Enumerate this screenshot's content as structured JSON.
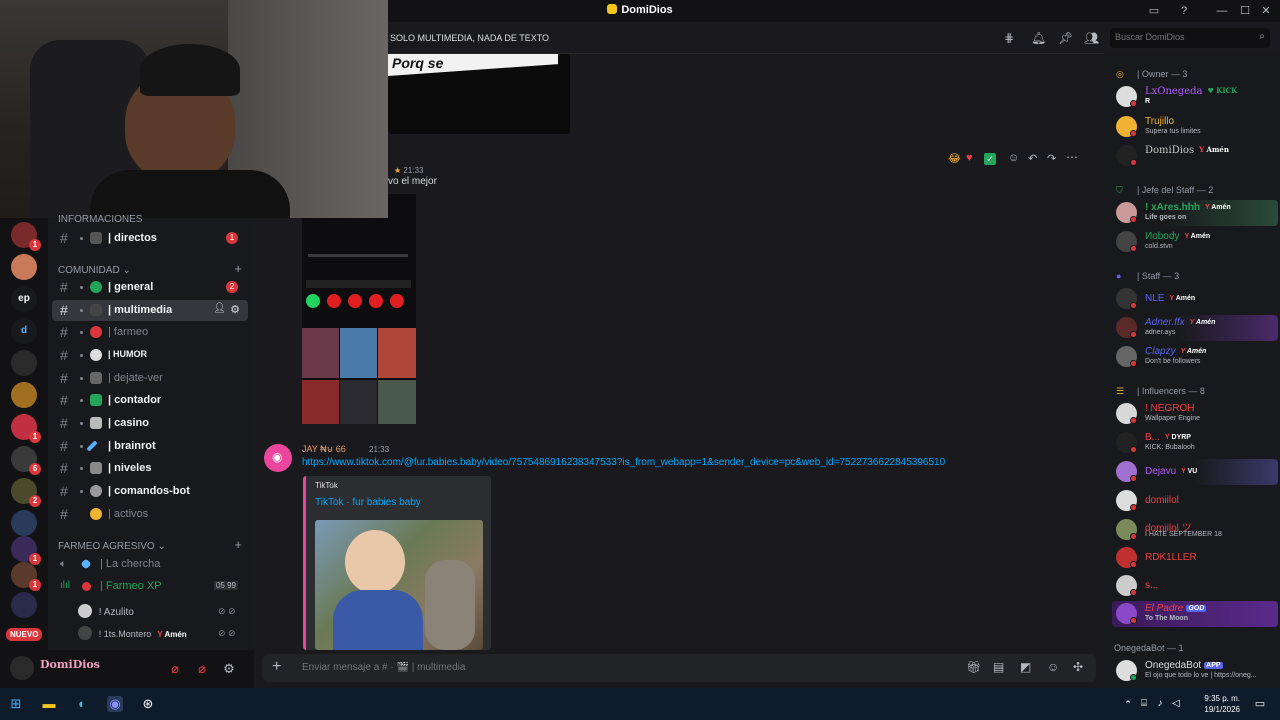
{
  "app": {
    "title": "DomiDios"
  },
  "header": {
    "channel_description": "SOLO MULTIMEDIA, NADA DE TEXTO",
    "search_placeholder": "Buscar DomiDios"
  },
  "servers": {
    "badges": [
      "1",
      "1",
      "6",
      "2",
      "1",
      "1"
    ],
    "ep_label": "ep",
    "new_label": "NUEVO"
  },
  "channels": {
    "cat_info": "INFORMACIONES",
    "directos": {
      "name": "| directos",
      "badge": "1"
    },
    "cat_comunidad": "COMUNIDAD",
    "items": [
      {
        "name": "| general",
        "badge": "2"
      },
      {
        "name": "| multimedia"
      },
      {
        "name": "| farmeo"
      },
      {
        "name": "| HUMOR"
      },
      {
        "name": "| dejate-ver"
      },
      {
        "name": "| contador"
      },
      {
        "name": "| casino"
      },
      {
        "name": "| brainrot"
      },
      {
        "name": "| niveles"
      },
      {
        "name": "| comandos-bot"
      },
      {
        "name": "| activos"
      }
    ],
    "cat_farmeo": "FARMEO AGRESIVO",
    "voice": [
      {
        "name": "| La chercha"
      },
      {
        "name": "| Farmeo XP",
        "counts": "05 99"
      }
    ],
    "voice_users": [
      {
        "name": "! Azulito"
      },
      {
        "name": "! 1ts.Montero",
        "tag": "Amén"
      }
    ]
  },
  "user_panel": {
    "username": "DomiDios"
  },
  "messages": [
    {
      "time": "21:33",
      "text": "vo el mejor",
      "overlay": "Porq se"
    },
    {
      "author": "JAY ₦⊍ 66",
      "time": "21:33",
      "link": "https://www.tiktok.com/@fur.babies.baby/video/7575486916238347533?is_from_webapp=1&sender_device=pc&web_id=7522736622845396510",
      "embed": {
        "provider": "TikTok",
        "title": "TikTok · fur babies baby"
      }
    }
  ],
  "composer": {
    "placeholder": "Enviar mensaje a # · 🎬 | multimedia"
  },
  "members": {
    "groups": [
      {
        "title": "| Owner — 3",
        "items": [
          {
            "name": "LxOnegeda",
            "sub": "R",
            "tag": "KICK",
            "color": "#b25aff"
          },
          {
            "name": "Trujillo",
            "sub": "Supera tus limites",
            "color": "#f0b232"
          },
          {
            "name": "DomiDios",
            "tag": "Amén",
            "color": "#c8c8c8"
          }
        ]
      },
      {
        "title": "| Jefe del Staff — 2",
        "items": [
          {
            "name": "! xAres.hhh",
            "sub": "Life goes on",
            "tag": "Amén",
            "color": "#23a55a"
          },
          {
            "name": "Иobody",
            "sub": "cold.stvn",
            "tag": "Amén",
            "color": "#23a55a"
          }
        ]
      },
      {
        "title": "| Staff — 3",
        "items": [
          {
            "name": "NLE",
            "tag": "Amén",
            "color": "#5865f2"
          },
          {
            "name": "Adner.ffx",
            "sub": "adner.ays",
            "tag": "Amén",
            "color": "#5865f2"
          },
          {
            "name": "Clapzy",
            "sub": "Don't be followers",
            "tag": "Amén",
            "color": "#5865f2"
          }
        ]
      },
      {
        "title": "| Influencers — 8",
        "items": [
          {
            "name": "! NEGROH",
            "sub": "Wallpaper Engine",
            "color": "#f23f43"
          },
          {
            "name": "B...",
            "sub": "KICK: Bubalooh",
            "tag": "DYRP",
            "color": "#f23f43"
          },
          {
            "name": "Dejavu",
            "tag": "VU",
            "color": "#b25aff"
          },
          {
            "name": "domiilol",
            "color": "#f23f43"
          },
          {
            "name": "domiilol ツ",
            "sub": "I HATE SEPTEMBER 18",
            "color": "#f23f43"
          },
          {
            "name": "RDK1LLER",
            "color": "#f23f43"
          },
          {
            "name": "s...",
            "color": "#f23f43"
          },
          {
            "name": "El Padre",
            "sub": "To The Moon",
            "tag": "GOD",
            "color": "#f23f43"
          }
        ]
      },
      {
        "title": "OnegedaBot — 1",
        "items": [
          {
            "name": "OnegedaBot",
            "sub": "El ojo que todo lo ve | https://oneg...",
            "tag": "APP",
            "color": "#dbdee1"
          }
        ]
      }
    ]
  },
  "taskbar": {
    "time": "9:35 p. m.",
    "date": "19/1/2026"
  }
}
